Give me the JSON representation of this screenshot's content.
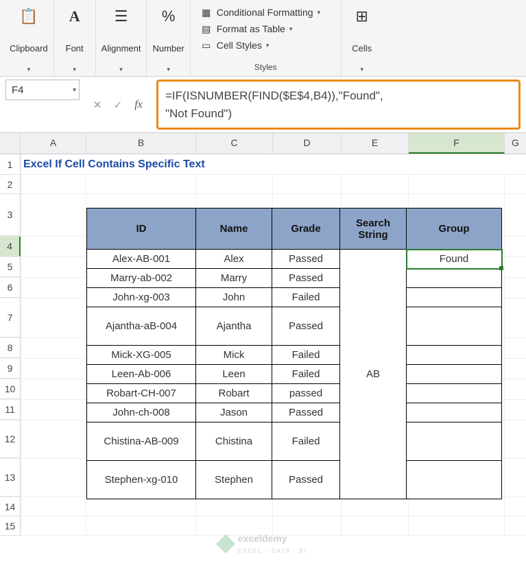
{
  "ribbon": {
    "clipboard": "Clipboard",
    "font": "Font",
    "alignment": "Alignment",
    "number": "Number",
    "styles_label": "Styles",
    "cond_formatting": "Conditional Formatting",
    "format_as_table": "Format as Table",
    "cell_styles": "Cell Styles",
    "cells": "Cells"
  },
  "formula_bar": {
    "name_box": "F4",
    "fx": "fx",
    "formula_line1": "=IF(ISNUMBER(FIND($E$4,B4)),\"Found\",",
    "formula_line2": "\"Not Found\")"
  },
  "columns": {
    "A": "A",
    "B": "B",
    "C": "C",
    "D": "D",
    "E": "E",
    "F": "F",
    "G": "G"
  },
  "rows_labels": [
    "1",
    "2",
    "3",
    "4",
    "5",
    "6",
    "7",
    "8",
    "9",
    "10",
    "11",
    "12",
    "13",
    "14",
    "15"
  ],
  "title": "Excel If Cell Contains Specific Text",
  "table": {
    "headers": {
      "id": "ID",
      "name": "Name",
      "grade": "Grade",
      "search": "Search String",
      "group": "Group"
    },
    "search_value": "AB",
    "group_value": "Found",
    "rows": [
      {
        "id": "Alex-AB-001",
        "name": "Alex",
        "grade": "Passed"
      },
      {
        "id": "Marry-ab-002",
        "name": "Marry",
        "grade": "Passed"
      },
      {
        "id": "John-xg-003",
        "name": "John",
        "grade": "Failed"
      },
      {
        "id": "Ajantha-aB-004",
        "name": "Ajantha",
        "grade": "Passed",
        "tall": true
      },
      {
        "id": "Mick-XG-005",
        "name": "Mick",
        "grade": "Failed"
      },
      {
        "id": "Leen-Ab-006",
        "name": "Leen",
        "grade": "Failed"
      },
      {
        "id": "Robart-CH-007",
        "name": "Robart",
        "grade": "passed"
      },
      {
        "id": "John-ch-008",
        "name": "Jason",
        "grade": "Passed"
      },
      {
        "id": "Chistina-AB-009",
        "name": "Chistina",
        "grade": "Failed",
        "tall": true
      },
      {
        "id": "Stephen-xg-010",
        "name": "Stephen",
        "grade": "Passed",
        "tall": true
      }
    ]
  },
  "watermark": {
    "text": "exceldemy",
    "sub": "EXCEL · DATA · BI"
  },
  "colors": {
    "header_bg": "#8ca4c8",
    "accent": "#e88a1a",
    "selection": "#2a7a2a"
  }
}
